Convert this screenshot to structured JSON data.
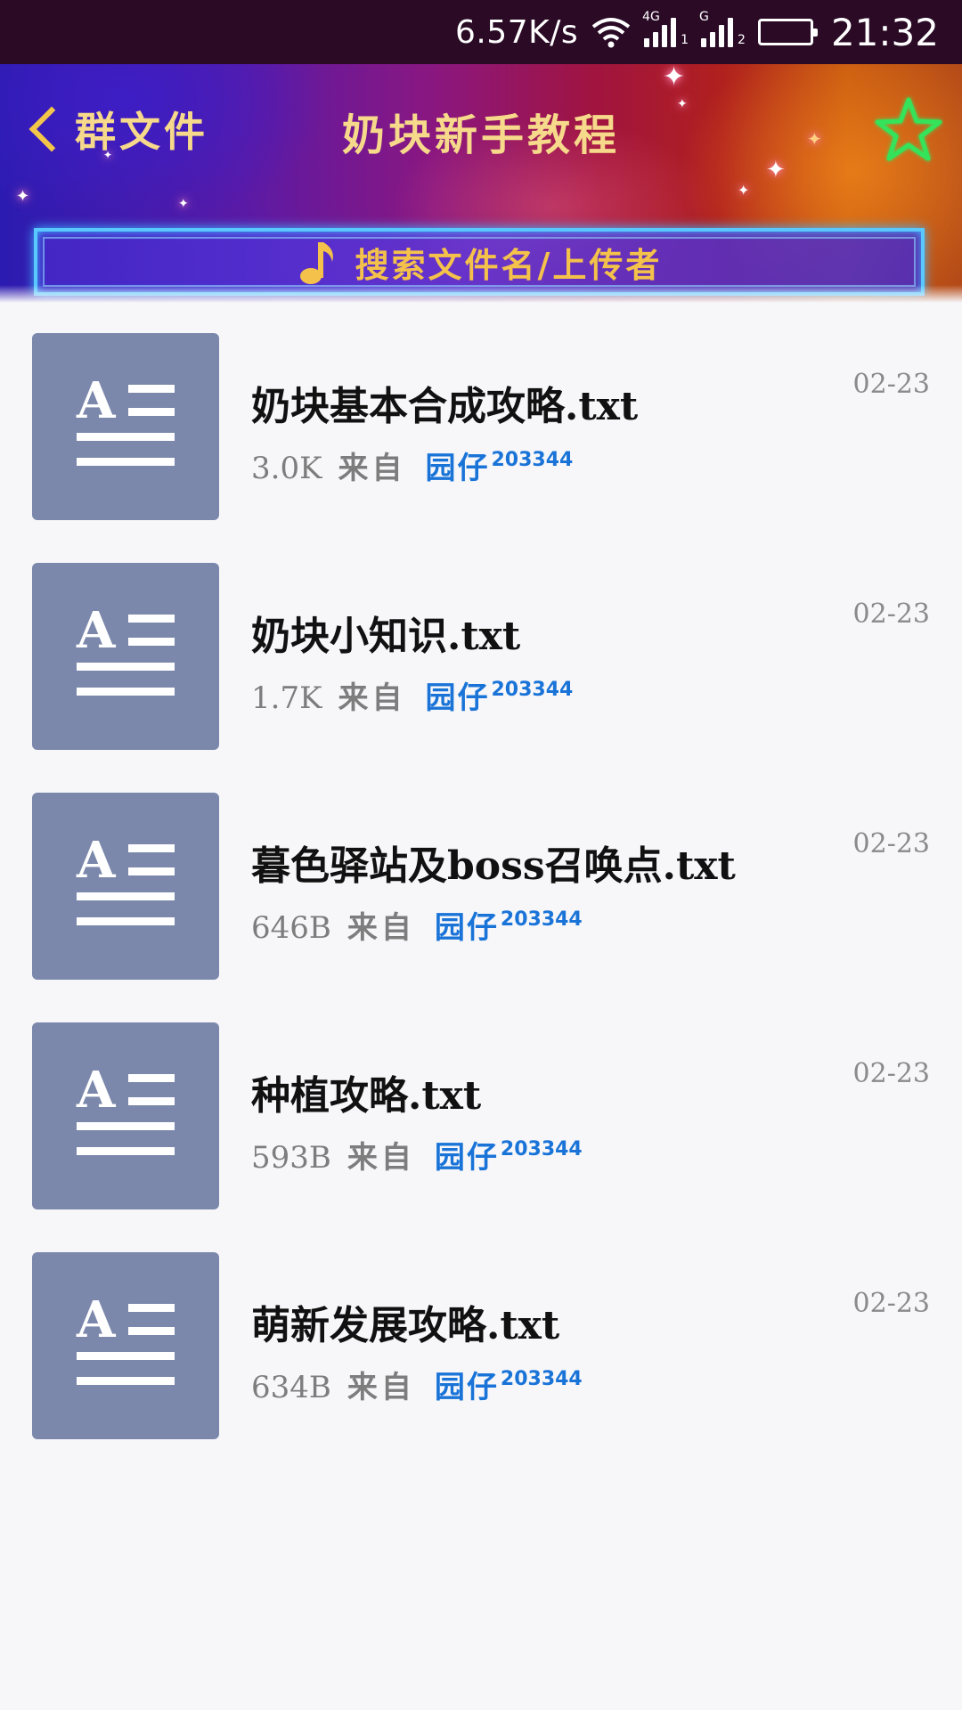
{
  "status_bar": {
    "net_speed": "6.57K/s",
    "sim1_label": "4G",
    "sim1_sub": "1",
    "sim2_label": "G",
    "sim2_sub": "2",
    "time": "21:32"
  },
  "header": {
    "back_label": "群文件",
    "title": "奶块新手教程",
    "search_placeholder": "搜索文件名/上传者"
  },
  "colors": {
    "title_gold": "#f6d98a",
    "search_text": "#f4c24a",
    "uploader_blue": "#1a74d8",
    "thumb_bg": "#7b88ab"
  },
  "files": [
    {
      "name": "奶块基本合成攻略.txt",
      "size": "3.0K",
      "from": "来自",
      "uploader": "园仔",
      "uploader_id": "203344",
      "date": "02-23"
    },
    {
      "name": "奶块小知识.txt",
      "size": "1.7K",
      "from": "来自",
      "uploader": "园仔",
      "uploader_id": "203344",
      "date": "02-23"
    },
    {
      "name": "暮色驿站及boss召唤点.txt",
      "size": "646B",
      "from": "来自",
      "uploader": "园仔",
      "uploader_id": "203344",
      "date": "02-23"
    },
    {
      "name": "种植攻略.txt",
      "size": "593B",
      "from": "来自",
      "uploader": "园仔",
      "uploader_id": "203344",
      "date": "02-23"
    },
    {
      "name": "萌新发展攻略.txt",
      "size": "634B",
      "from": "来自",
      "uploader": "园仔",
      "uploader_id": "203344",
      "date": "02-23"
    }
  ]
}
